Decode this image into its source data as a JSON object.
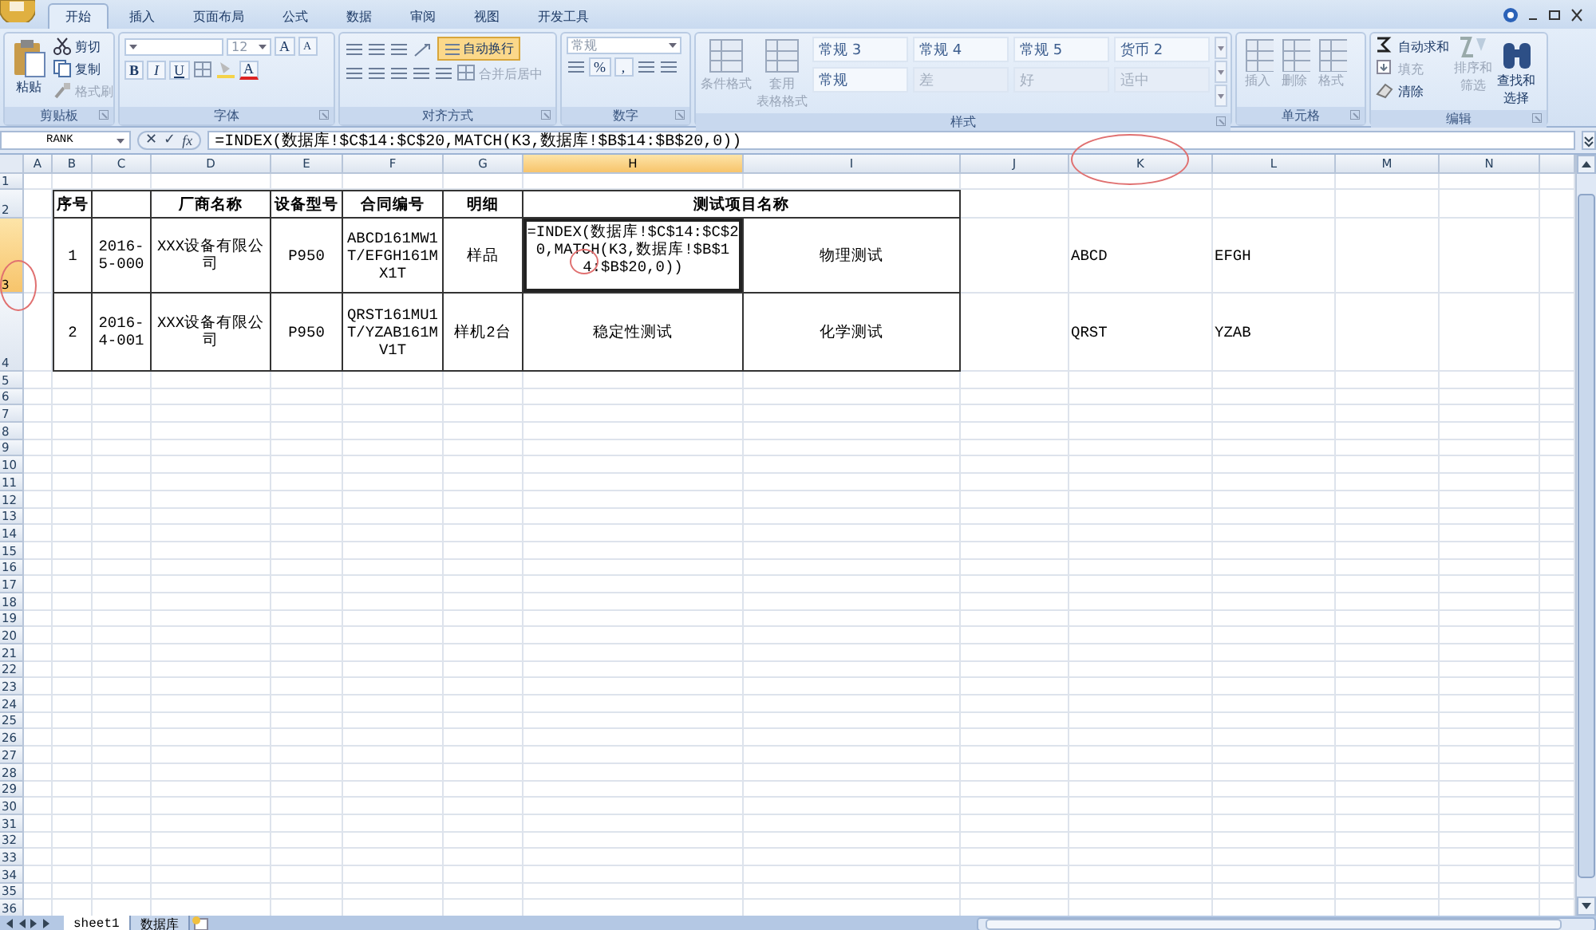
{
  "ribbon_tabs": [
    {
      "label": "开始",
      "selected": true
    },
    {
      "label": "插入",
      "selected": false
    },
    {
      "label": "页面布局",
      "selected": false
    },
    {
      "label": "公式",
      "selected": false
    },
    {
      "label": "数据",
      "selected": false
    },
    {
      "label": "审阅",
      "selected": false
    },
    {
      "label": "视图",
      "selected": false
    },
    {
      "label": "开发工具",
      "selected": false
    }
  ],
  "clipboard": {
    "label": "剪贴板",
    "paste": "粘贴",
    "cut": "剪切",
    "copy": "复制",
    "format_painter": "格式刷"
  },
  "font": {
    "label": "字体",
    "size": "12",
    "grow": "A",
    "shrink": "A",
    "bold": "B",
    "italic": "I",
    "underline": "U",
    "font_color": "A"
  },
  "alignment": {
    "label": "对齐方式",
    "wrap_text": {
      "label": "自动换行",
      "on": true
    },
    "merge": "合并后居中"
  },
  "number": {
    "label": "数字",
    "format": "常规",
    "percent": "%",
    "comma": ","
  },
  "styles": {
    "label": "样式",
    "conditional": "条件格式",
    "table_format": [
      "套用",
      "表格格式"
    ],
    "gallery": [
      {
        "label": "常规 3",
        "disabled": false
      },
      {
        "label": "常规 4",
        "disabled": false
      },
      {
        "label": "常规 5",
        "disabled": false
      },
      {
        "label": "货币 2",
        "disabled": false
      },
      {
        "label": "常规",
        "disabled": false
      },
      {
        "label": "差",
        "disabled": true
      },
      {
        "label": "好",
        "disabled": true
      },
      {
        "label": "适中",
        "disabled": true
      }
    ]
  },
  "cells": {
    "label": "单元格",
    "buttons": [
      "插入",
      "删除",
      "格式"
    ]
  },
  "editing": {
    "label": "编辑",
    "autosum": {
      "label": "自动求和",
      "disabled": false
    },
    "fill": {
      "label": "填充",
      "disabled": true
    },
    "clear": {
      "label": "清除",
      "disabled": false
    },
    "sort": {
      "label": [
        "排序和",
        "筛选"
      ],
      "disabled": true
    },
    "find": {
      "label": [
        "查找和",
        "选择"
      ],
      "disabled": false
    }
  },
  "formula_bar": {
    "name_box": "RANK",
    "cancel": "✕",
    "enter": "✓",
    "fx": "fx",
    "formula": "=INDEX(数据库!$C$14:$C$20,MATCH(K3,数据库!$B$14:$B$20,0))"
  },
  "sheet": {
    "columns": [
      {
        "label": "A",
        "selected": false
      },
      {
        "label": "B",
        "selected": false
      },
      {
        "label": "C",
        "selected": false
      },
      {
        "label": "D",
        "selected": false
      },
      {
        "label": "E",
        "selected": false
      },
      {
        "label": "F",
        "selected": false
      },
      {
        "label": "G",
        "selected": false
      },
      {
        "label": "H",
        "selected": true
      },
      {
        "label": "I",
        "selected": false
      },
      {
        "label": "J",
        "selected": false
      },
      {
        "label": "K",
        "selected": false
      },
      {
        "label": "L",
        "selected": false
      },
      {
        "label": "M",
        "selected": false
      },
      {
        "label": "N",
        "selected": false
      }
    ],
    "rows": [
      {
        "number": "1",
        "selected": false
      },
      {
        "number": "2",
        "selected": false,
        "cells": [
          {
            "text": "",
            "kind": "data",
            "bordered": false
          },
          {
            "text": "序号",
            "kind": "header",
            "bordered": true
          },
          {
            "text": "",
            "kind": "header",
            "bordered": true
          },
          {
            "text": "厂商名称",
            "kind": "header",
            "bordered": true
          },
          {
            "text": "设备型号",
            "kind": "header",
            "bordered": true
          },
          {
            "text": "合同编号",
            "kind": "header",
            "bordered": true
          },
          {
            "text": "明细",
            "kind": "header",
            "bordered": true
          },
          {
            "text": "测试项目名称",
            "kind": "header",
            "bordered": true,
            "colspan": 2
          }
        ]
      },
      {
        "number": "3",
        "selected": true,
        "cells": [
          {
            "text": "",
            "kind": "data",
            "bordered": false
          },
          {
            "text": "1",
            "kind": "data",
            "bordered": true
          },
          {
            "text": "2016-5-000",
            "kind": "data",
            "bordered": true
          },
          {
            "text": "XXX设备有限公司",
            "kind": "data",
            "bordered": true
          },
          {
            "text": "P950",
            "kind": "data",
            "bordered": true
          },
          {
            "text": "ABCD161MW1T/EFGH161MX1T",
            "kind": "data",
            "bordered": true
          },
          {
            "text": "样品",
            "kind": "data",
            "bordered": true
          },
          {
            "text": "=INDEX(数据库!$C$14:$C$20,MATCH(K3,数据库!$B$14:$B$20,0))",
            "kind": "editing",
            "bordered": true
          },
          {
            "text": "物理测试",
            "kind": "data",
            "bordered": true
          },
          {
            "text": "",
            "kind": "data",
            "bordered": false
          },
          {
            "text": "ABCD",
            "kind": "side",
            "bordered": false
          },
          {
            "text": "EFGH",
            "kind": "side",
            "bordered": false
          }
        ]
      },
      {
        "number": "4",
        "selected": false,
        "cells": [
          {
            "text": "",
            "kind": "data",
            "bordered": false
          },
          {
            "text": "2",
            "kind": "data",
            "bordered": true
          },
          {
            "text": "2016-4-001",
            "kind": "data",
            "bordered": true
          },
          {
            "text": "XXX设备有限公司",
            "kind": "data",
            "bordered": true
          },
          {
            "text": "P950",
            "kind": "data",
            "bordered": true
          },
          {
            "text": "QRST161MU1T/YZAB161MV1T",
            "kind": "data",
            "bordered": true
          },
          {
            "text": "样机2台",
            "kind": "data",
            "bordered": true
          },
          {
            "text": "稳定性测试",
            "kind": "data",
            "bordered": true
          },
          {
            "text": "化学测试",
            "kind": "data",
            "bordered": true
          },
          {
            "text": "",
            "kind": "data",
            "bordered": false
          },
          {
            "text": "QRST",
            "kind": "side",
            "bordered": false
          },
          {
            "text": "YZAB",
            "kind": "side",
            "bordered": false
          }
        ]
      },
      {
        "number": "5",
        "selected": false
      },
      {
        "number": "6",
        "selected": false
      },
      {
        "number": "7",
        "selected": false
      },
      {
        "number": "8",
        "selected": false
      },
      {
        "number": "9",
        "selected": false
      },
      {
        "number": "10",
        "selected": false
      },
      {
        "number": "11",
        "selected": false
      },
      {
        "number": "12",
        "selected": false
      },
      {
        "number": "13",
        "selected": false
      },
      {
        "number": "14",
        "selected": false
      },
      {
        "number": "15",
        "selected": false
      },
      {
        "number": "16",
        "selected": false
      },
      {
        "number": "17",
        "selected": false
      },
      {
        "number": "18",
        "selected": false
      },
      {
        "number": "19",
        "selected": false
      },
      {
        "number": "20",
        "selected": false
      },
      {
        "number": "21",
        "selected": false
      },
      {
        "number": "22",
        "selected": false
      },
      {
        "number": "23",
        "selected": false
      },
      {
        "number": "24",
        "selected": false
      },
      {
        "number": "25",
        "selected": false
      },
      {
        "number": "26",
        "selected": false
      },
      {
        "number": "27",
        "selected": false
      },
      {
        "number": "28",
        "selected": false
      },
      {
        "number": "29",
        "selected": false
      },
      {
        "number": "30",
        "selected": false
      },
      {
        "number": "31",
        "selected": false
      },
      {
        "number": "32",
        "selected": false
      },
      {
        "number": "33",
        "selected": false
      },
      {
        "number": "34",
        "selected": false
      },
      {
        "number": "35",
        "selected": false
      },
      {
        "number": "36",
        "selected": false
      }
    ]
  },
  "sheet_tabs": [
    {
      "label": "sheet1",
      "selected": true
    },
    {
      "label": "数据库",
      "selected": false
    }
  ]
}
